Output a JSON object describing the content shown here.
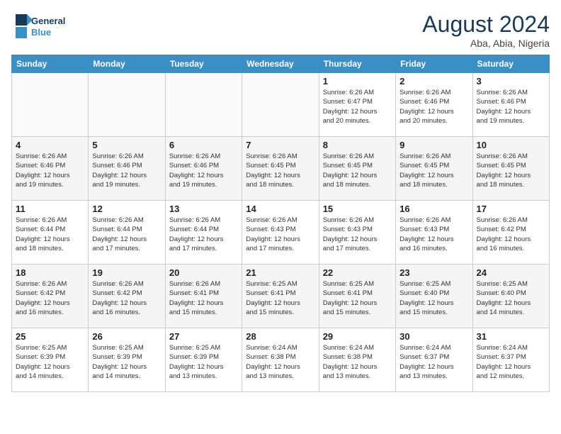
{
  "header": {
    "logo_line1": "General",
    "logo_line2": "Blue",
    "month_year": "August 2024",
    "location": "Aba, Abia, Nigeria"
  },
  "days_of_week": [
    "Sunday",
    "Monday",
    "Tuesday",
    "Wednesday",
    "Thursday",
    "Friday",
    "Saturday"
  ],
  "weeks": [
    [
      {
        "day": "",
        "detail": ""
      },
      {
        "day": "",
        "detail": ""
      },
      {
        "day": "",
        "detail": ""
      },
      {
        "day": "",
        "detail": ""
      },
      {
        "day": "1",
        "detail": "Sunrise: 6:26 AM\nSunset: 6:47 PM\nDaylight: 12 hours\nand 20 minutes."
      },
      {
        "day": "2",
        "detail": "Sunrise: 6:26 AM\nSunset: 6:46 PM\nDaylight: 12 hours\nand 20 minutes."
      },
      {
        "day": "3",
        "detail": "Sunrise: 6:26 AM\nSunset: 6:46 PM\nDaylight: 12 hours\nand 19 minutes."
      }
    ],
    [
      {
        "day": "4",
        "detail": "Sunrise: 6:26 AM\nSunset: 6:46 PM\nDaylight: 12 hours\nand 19 minutes."
      },
      {
        "day": "5",
        "detail": "Sunrise: 6:26 AM\nSunset: 6:46 PM\nDaylight: 12 hours\nand 19 minutes."
      },
      {
        "day": "6",
        "detail": "Sunrise: 6:26 AM\nSunset: 6:46 PM\nDaylight: 12 hours\nand 19 minutes."
      },
      {
        "day": "7",
        "detail": "Sunrise: 6:26 AM\nSunset: 6:45 PM\nDaylight: 12 hours\nand 18 minutes."
      },
      {
        "day": "8",
        "detail": "Sunrise: 6:26 AM\nSunset: 6:45 PM\nDaylight: 12 hours\nand 18 minutes."
      },
      {
        "day": "9",
        "detail": "Sunrise: 6:26 AM\nSunset: 6:45 PM\nDaylight: 12 hours\nand 18 minutes."
      },
      {
        "day": "10",
        "detail": "Sunrise: 6:26 AM\nSunset: 6:45 PM\nDaylight: 12 hours\nand 18 minutes."
      }
    ],
    [
      {
        "day": "11",
        "detail": "Sunrise: 6:26 AM\nSunset: 6:44 PM\nDaylight: 12 hours\nand 18 minutes."
      },
      {
        "day": "12",
        "detail": "Sunrise: 6:26 AM\nSunset: 6:44 PM\nDaylight: 12 hours\nand 17 minutes."
      },
      {
        "day": "13",
        "detail": "Sunrise: 6:26 AM\nSunset: 6:44 PM\nDaylight: 12 hours\nand 17 minutes."
      },
      {
        "day": "14",
        "detail": "Sunrise: 6:26 AM\nSunset: 6:43 PM\nDaylight: 12 hours\nand 17 minutes."
      },
      {
        "day": "15",
        "detail": "Sunrise: 6:26 AM\nSunset: 6:43 PM\nDaylight: 12 hours\nand 17 minutes."
      },
      {
        "day": "16",
        "detail": "Sunrise: 6:26 AM\nSunset: 6:43 PM\nDaylight: 12 hours\nand 16 minutes."
      },
      {
        "day": "17",
        "detail": "Sunrise: 6:26 AM\nSunset: 6:42 PM\nDaylight: 12 hours\nand 16 minutes."
      }
    ],
    [
      {
        "day": "18",
        "detail": "Sunrise: 6:26 AM\nSunset: 6:42 PM\nDaylight: 12 hours\nand 16 minutes."
      },
      {
        "day": "19",
        "detail": "Sunrise: 6:26 AM\nSunset: 6:42 PM\nDaylight: 12 hours\nand 16 minutes."
      },
      {
        "day": "20",
        "detail": "Sunrise: 6:26 AM\nSunset: 6:41 PM\nDaylight: 12 hours\nand 15 minutes."
      },
      {
        "day": "21",
        "detail": "Sunrise: 6:25 AM\nSunset: 6:41 PM\nDaylight: 12 hours\nand 15 minutes."
      },
      {
        "day": "22",
        "detail": "Sunrise: 6:25 AM\nSunset: 6:41 PM\nDaylight: 12 hours\nand 15 minutes."
      },
      {
        "day": "23",
        "detail": "Sunrise: 6:25 AM\nSunset: 6:40 PM\nDaylight: 12 hours\nand 15 minutes."
      },
      {
        "day": "24",
        "detail": "Sunrise: 6:25 AM\nSunset: 6:40 PM\nDaylight: 12 hours\nand 14 minutes."
      }
    ],
    [
      {
        "day": "25",
        "detail": "Sunrise: 6:25 AM\nSunset: 6:39 PM\nDaylight: 12 hours\nand 14 minutes."
      },
      {
        "day": "26",
        "detail": "Sunrise: 6:25 AM\nSunset: 6:39 PM\nDaylight: 12 hours\nand 14 minutes."
      },
      {
        "day": "27",
        "detail": "Sunrise: 6:25 AM\nSunset: 6:39 PM\nDaylight: 12 hours\nand 13 minutes."
      },
      {
        "day": "28",
        "detail": "Sunrise: 6:24 AM\nSunset: 6:38 PM\nDaylight: 12 hours\nand 13 minutes."
      },
      {
        "day": "29",
        "detail": "Sunrise: 6:24 AM\nSunset: 6:38 PM\nDaylight: 12 hours\nand 13 minutes."
      },
      {
        "day": "30",
        "detail": "Sunrise: 6:24 AM\nSunset: 6:37 PM\nDaylight: 12 hours\nand 13 minutes."
      },
      {
        "day": "31",
        "detail": "Sunrise: 6:24 AM\nSunset: 6:37 PM\nDaylight: 12 hours\nand 12 minutes."
      }
    ]
  ]
}
